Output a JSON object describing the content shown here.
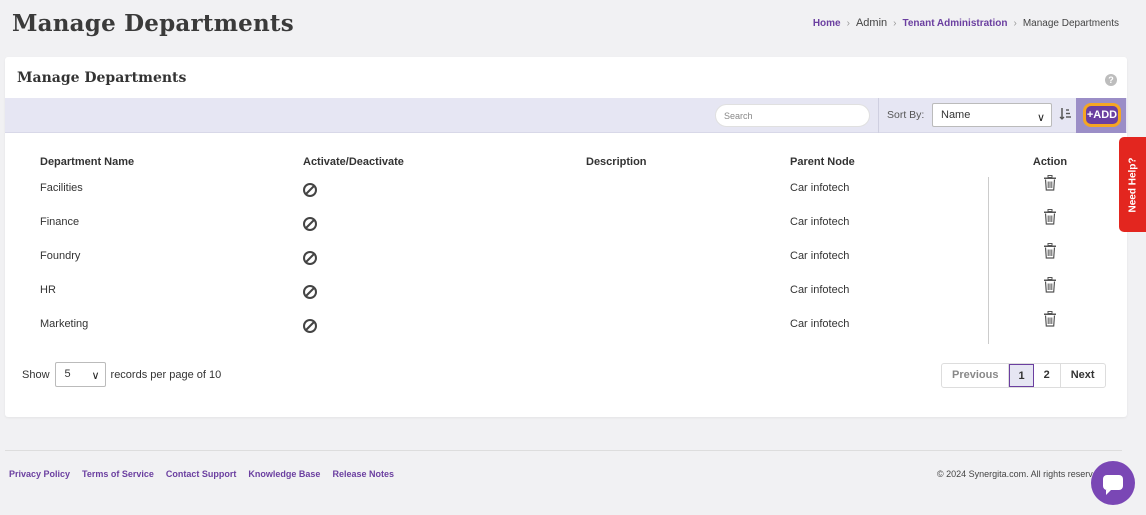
{
  "page": {
    "title": "Manage Departments"
  },
  "breadcrumb": {
    "items": [
      "Home",
      "Admin",
      "Tenant Administration",
      "Manage Departments"
    ]
  },
  "card": {
    "title": "Manage Departments",
    "help": "?"
  },
  "toolbar": {
    "search_placeholder": "Search",
    "sort_label": "Sort By:",
    "sort_value": "Name",
    "add_label": "+ADD"
  },
  "table": {
    "headers": [
      "Department Name",
      "Activate/Deactivate",
      "Description",
      "Parent Node",
      "Action"
    ],
    "rows": [
      {
        "name": "Facilities",
        "description": "",
        "parent": "Car infotech"
      },
      {
        "name": "Finance",
        "description": "",
        "parent": "Car infotech"
      },
      {
        "name": "Foundry",
        "description": "",
        "parent": "Car infotech"
      },
      {
        "name": "HR",
        "description": "",
        "parent": "Car infotech"
      },
      {
        "name": "Marketing",
        "description": "",
        "parent": "Car infotech"
      }
    ]
  },
  "pagination": {
    "show_label": "Show",
    "per_page": "5",
    "records_label": "records per page of 10",
    "previous": "Previous",
    "pages": [
      "1",
      "2"
    ],
    "next": "Next",
    "active_page": "1"
  },
  "footer": {
    "links": [
      "Privacy Policy",
      "Terms of Service",
      "Contact Support",
      "Knowledge Base",
      "Release Notes"
    ],
    "copyright": "© 2024 Synergita.com. All rights reserved."
  },
  "need_help": "Need Help?",
  "colors": {
    "brand_purple": "#6b3fa0",
    "add_border": "#f5a623",
    "need_help_red": "#e3261f",
    "toolbar_bg": "#e6e6f3"
  },
  "icons": {
    "activate": "block-icon",
    "action": "trash-icon",
    "chat": "chat-icon"
  }
}
